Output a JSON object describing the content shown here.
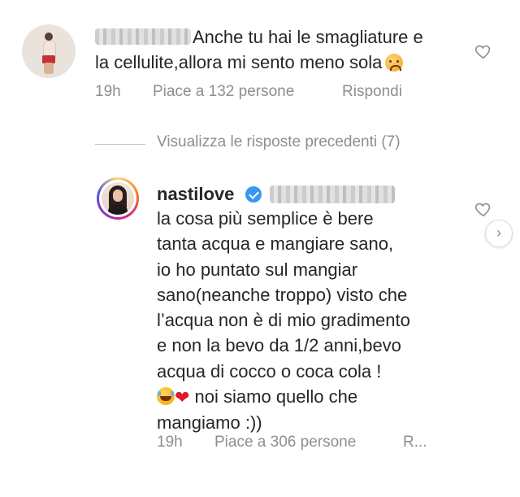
{
  "comment1": {
    "text_line1": "Anche tu hai le smagliature e",
    "text_line2": "la cellulite,allora mi sento meno sola",
    "time": "19h",
    "likes": "Piace a 132 persone",
    "reply": "Rispondi"
  },
  "view_previous_replies": "Visualizza le risposte precedenti (7)",
  "comment2": {
    "username": "nastilove",
    "lines": [
      "la cosa più semplice è bere",
      "tanta acqua e mangiare sano,",
      "io ho puntato sul mangiar",
      "sano(neanche troppo) visto che",
      "l’acqua non è di mio gradimento",
      "e non la bevo da 1/2 anni,bevo",
      "acqua di cocco o coca cola !"
    ],
    "line8_text": " noi siamo quello che",
    "line9": "mangiamo :))",
    "time": "19h",
    "likes": "Piace a 306 persone",
    "reply_truncated": "R..."
  },
  "icons": {
    "heart": "heart-outline-icon",
    "verified": "verified-badge-icon",
    "next": "chevron-right-icon",
    "emoji_sad": "frowning-face-emoji",
    "emoji_laugh": "tears-of-joy-emoji",
    "emoji_heart": "red-heart-emoji"
  },
  "colors": {
    "text": "#262626",
    "muted": "#8e8e8e",
    "verified": "#3897f0",
    "heart_emoji": "#e0172d"
  }
}
